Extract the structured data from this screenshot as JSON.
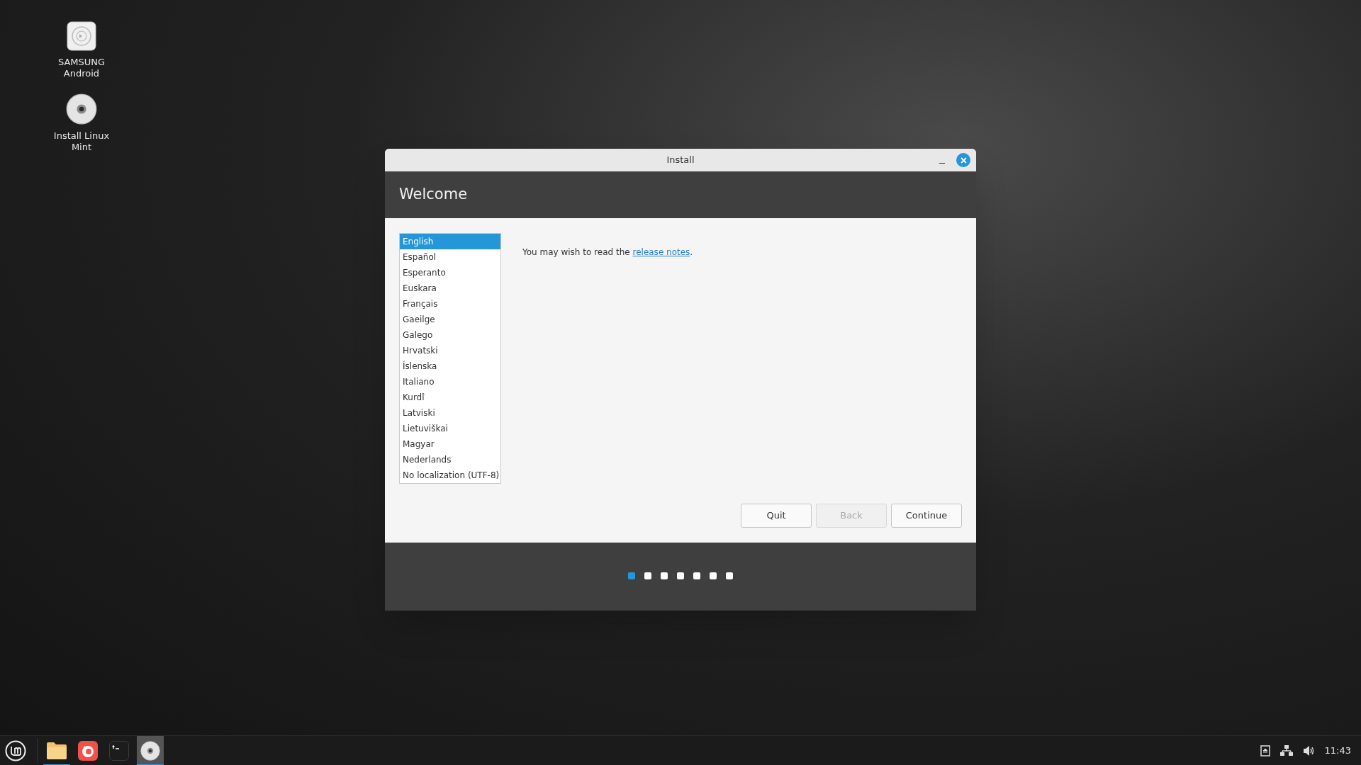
{
  "desktop_icons": [
    {
      "kind": "player",
      "label": "SAMSUNG Android"
    },
    {
      "kind": "disc",
      "label": "Install Linux Mint"
    }
  ],
  "window": {
    "title": "Install",
    "heading": "Welcome",
    "languages": [
      {
        "label": "English",
        "selected": true
      },
      {
        "label": "Español",
        "selected": false
      },
      {
        "label": "Esperanto",
        "selected": false
      },
      {
        "label": "Euskara",
        "selected": false
      },
      {
        "label": "Français",
        "selected": false
      },
      {
        "label": "Gaeilge",
        "selected": false
      },
      {
        "label": "Galego",
        "selected": false
      },
      {
        "label": "Hrvatski",
        "selected": false
      },
      {
        "label": "Íslenska",
        "selected": false
      },
      {
        "label": "Italiano",
        "selected": false
      },
      {
        "label": "Kurdî",
        "selected": false
      },
      {
        "label": "Latviski",
        "selected": false
      },
      {
        "label": "Lietuviškai",
        "selected": false
      },
      {
        "label": "Magyar",
        "selected": false
      },
      {
        "label": "Nederlands",
        "selected": false
      },
      {
        "label": "No localization (UTF-8)",
        "selected": false
      }
    ],
    "message": "You may wish to read the",
    "link": "release notes",
    "message_end": ".",
    "buttons": [
      {
        "label": "Quit",
        "disabled": false
      },
      {
        "label": "Back",
        "disabled": true
      },
      {
        "label": "Continue",
        "disabled": false
      }
    ],
    "steps": [
      {
        "selected": true
      },
      {
        "selected": false
      },
      {
        "selected": false
      },
      {
        "selected": false
      },
      {
        "selected": false
      },
      {
        "selected": false
      },
      {
        "selected": false
      }
    ]
  },
  "taskbar": {
    "apps": [
      {
        "kind": "folder",
        "running": true,
        "selected": false
      },
      {
        "kind": "browser",
        "running": false,
        "selected": false
      },
      {
        "kind": "terminal",
        "running": false,
        "selected": false
      },
      {
        "kind": "disc",
        "running": true,
        "selected": true
      }
    ],
    "clock": "11:43"
  }
}
